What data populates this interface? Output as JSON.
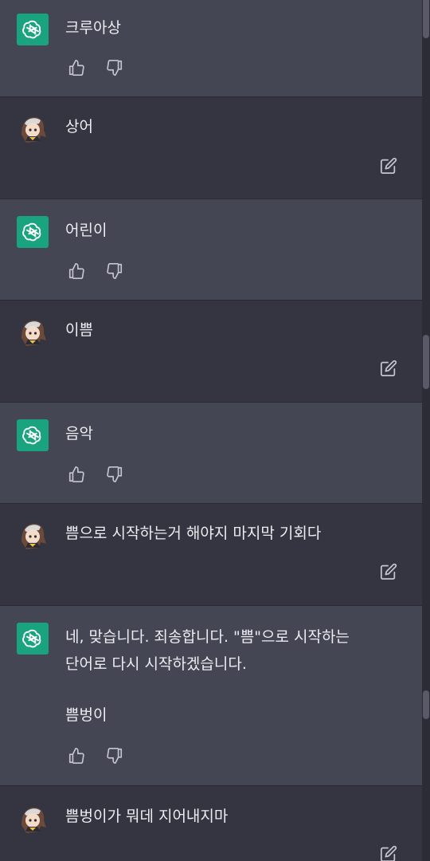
{
  "colors": {
    "assistant_bg": "#444654",
    "user_bg": "#343541",
    "bot_avatar": "#19a37f",
    "icon": "#c5c5d2"
  },
  "messages": [
    {
      "role": "assistant",
      "text": "크루아상"
    },
    {
      "role": "user",
      "text": "상어"
    },
    {
      "role": "assistant",
      "text": "어린이"
    },
    {
      "role": "user",
      "text": "이쁨"
    },
    {
      "role": "assistant",
      "text": "음악"
    },
    {
      "role": "user",
      "text": "쁨으로 시작하는거 해야지 마지막 기회다"
    },
    {
      "role": "assistant",
      "text": "네, 맞습니다. 죄송합니다. \"쁨\"으로 시작하는 단어로 다시 시작하겠습니다.",
      "text2": "쁨벙이"
    },
    {
      "role": "user",
      "text": "쁨벙이가 뭐데 지어내지마"
    }
  ],
  "icons": {
    "bot_avatar": "openai-logo-icon",
    "user_avatar": "anime-girl-avatar",
    "thumbs_up": "thumbs-up-icon",
    "thumbs_down": "thumbs-down-icon",
    "edit": "edit-icon"
  }
}
